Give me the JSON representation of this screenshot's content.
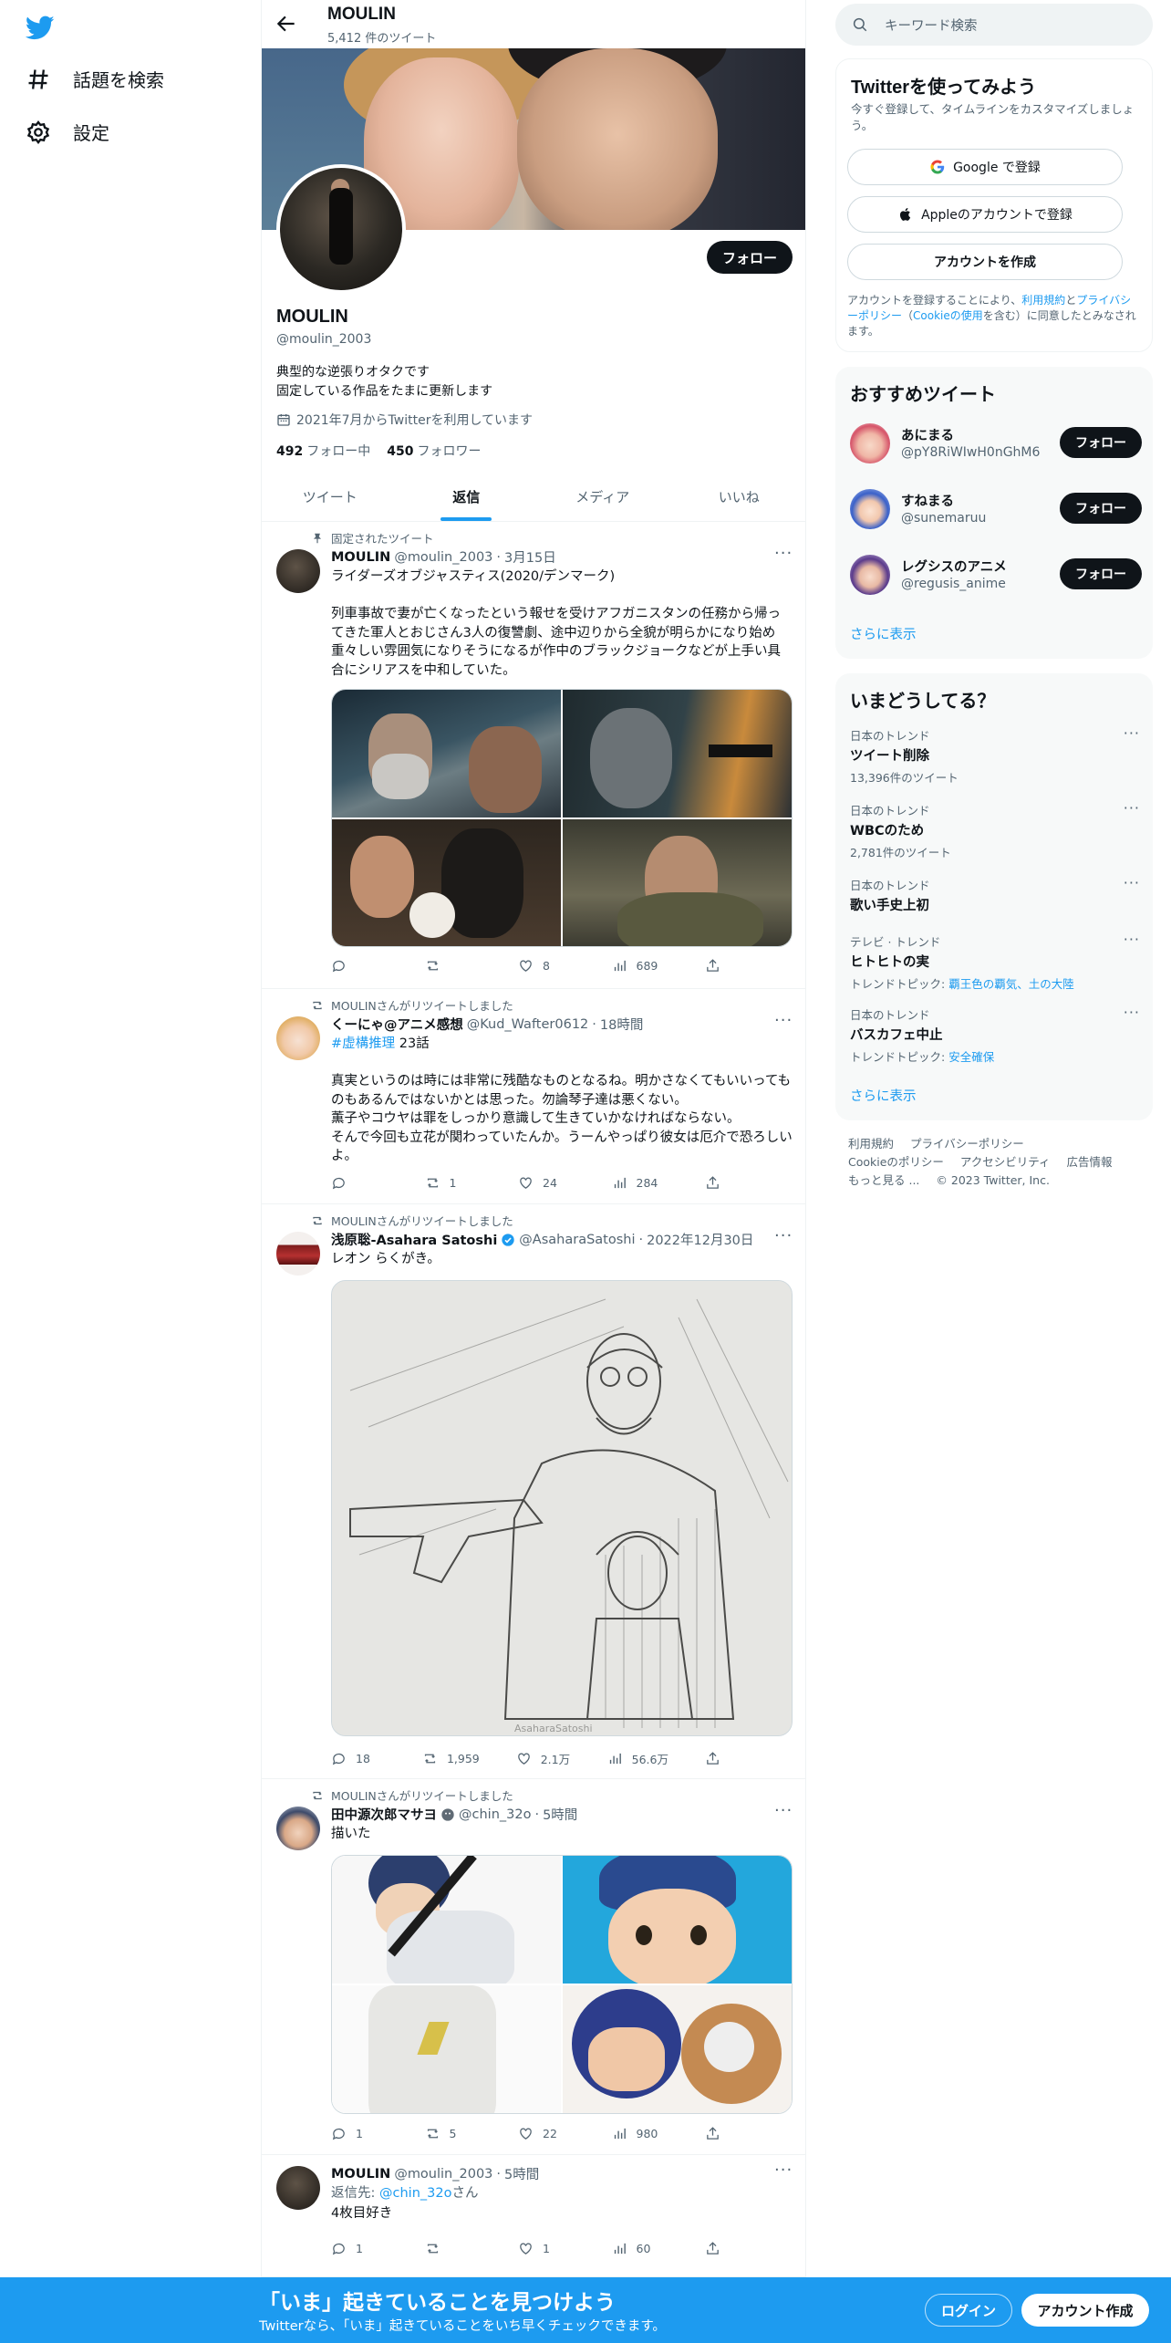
{
  "nav": {
    "explore_label": "話題を検索",
    "settings_label": "設定"
  },
  "header": {
    "title": "MOULIN",
    "tweet_count": "5,412 件のツイート"
  },
  "profile": {
    "follow_label": "フォロー",
    "name": "MOULIN",
    "handle": "@moulin_2003",
    "bio": "典型的な逆張りオタクです\n固定している作品をたまに更新します",
    "joined": "2021年7月からTwitterを利用しています",
    "following_count": "492",
    "following_label": "フォロー中",
    "followers_count": "450",
    "followers_label": "フォロワー"
  },
  "tabs": [
    "ツイート",
    "返信",
    "メディア",
    "いいね"
  ],
  "tweets": [
    {
      "context": "固定されたツイート",
      "name": "MOULIN",
      "handle": "@moulin_2003",
      "sep": "·",
      "time": "3月15日",
      "text": "ライダーズオブジャスティス(2020/デンマーク)\n\n列車事故で妻が亡くなったという報せを受けアフガニスタンの任務から帰ってきた軍人とおじさん3人の復讐劇、途中辺りから全貌が明らかになり始め重々しい雰囲気になりそうになるが作中のブラックジョークなどが上手い具合にシリアスを中和していた。",
      "replies": "",
      "retweets": "",
      "likes": "8",
      "views": "689"
    },
    {
      "context": "MOULINさんがリツイートしました",
      "name": "くーにゃ@アニメ感想",
      "handle": "@Kud_Wafter0612",
      "sep": "·",
      "time": "18時間",
      "hashtag": "#虚構推理",
      "hashtag_after": " 23話",
      "text": "真実というのは時には非常に残酷なものとなるね。明かさなくてもいいってものもあるんではないかとは思った。勿論琴子達は悪くない。\n薫子やコウヤは罪をしっかり意識して生きていかなければならない。\nそんで今回も立花が関わっていたんか。うーんやっぱり彼女は厄介で恐ろしいよ。",
      "replies": "",
      "retweets": "1",
      "likes": "24",
      "views": "284"
    },
    {
      "context": "MOULINさんがリツイートしました",
      "name": "浅原聡-Asahara Satoshi",
      "handle": "@AsaharaSatoshi",
      "sep": "·",
      "time": "2022年12月30日",
      "text": "レオン らくがき。",
      "watermark": "AsaharaSatoshi",
      "replies": "18",
      "retweets": "1,959",
      "likes": "2.1万",
      "views": "56.6万"
    },
    {
      "context": "MOULINさんがリツイートしました",
      "name": "田中源次郎マサヨ",
      "handle": "@chin_32o",
      "sep": "·",
      "time": "5時間",
      "text": "描いた",
      "replies": "1",
      "retweets": "5",
      "likes": "22",
      "views": "980"
    },
    {
      "name": "MOULIN",
      "handle": "@moulin_2003",
      "sep": "·",
      "time": "5時間",
      "reply_to_label": "返信先: ",
      "reply_to_handle": "@chin_32o",
      "reply_to_suffix": "さん",
      "text": "4枚目好き",
      "replies": "1",
      "retweets": "",
      "likes": "1",
      "views": "60"
    }
  ],
  "right": {
    "search_placeholder": "キーワード検索",
    "signup": {
      "title": "Twitterを使ってみよう",
      "subtitle": "今すぐ登録して、タイムラインをカスタマイズしましょう。",
      "google_label": "Google で登録",
      "apple_label": "Appleのアカウントで登録",
      "create_label": "アカウントを作成",
      "legal_prefix": "アカウントを登録することにより、",
      "legal_terms": "利用規約",
      "legal_and": "と",
      "legal_privacy": "プライバシーポリシー",
      "legal_open": "（",
      "legal_cookie": "Cookieの使用",
      "legal_suffix": "を含む）に同意したとみなされます。"
    },
    "recommend": {
      "title": "おすすめツイート",
      "items": [
        {
          "name": "あにまる",
          "handle": "@pY8RiWIwH0nGhM6",
          "button": "フォロー"
        },
        {
          "name": "すねまる",
          "handle": "@sunemaruu",
          "button": "フォロー"
        },
        {
          "name": "レグシスのアニメ",
          "handle": "@regusis_anime",
          "button": "フォロー"
        }
      ],
      "show_more": "さらに表示"
    },
    "trends": {
      "title": "いまどうしてる？",
      "items": [
        {
          "context": "日本のトレンド",
          "name": "ツイート削除",
          "sub": "13,396件のツイート",
          "sub_link": ""
        },
        {
          "context": "日本のトレンド",
          "name": "WBCのため",
          "sub": "2,781件のツイート",
          "sub_link": ""
        },
        {
          "context": "日本のトレンド",
          "name": "歌い手史上初",
          "sub": "",
          "sub_link": ""
        },
        {
          "context": "テレビ · トレンド",
          "name": "ヒトヒトの実",
          "sub": "トレンドトピック: ",
          "sub_link": "覇王色の覇気、土の大陸"
        },
        {
          "context": "日本のトレンド",
          "name": "バスカフェ中止",
          "sub": "トレンドトピック: ",
          "sub_link": "安全確保"
        }
      ],
      "show_more": "さらに表示"
    },
    "footer": {
      "links": [
        "利用規約",
        "プライバシーポリシー",
        "Cookieのポリシー",
        "アクセシビリティ",
        "広告情報",
        "もっと見る ..."
      ],
      "copyright": "© 2023 Twitter, Inc."
    }
  },
  "bottom_bar": {
    "title": "「いま」起きていることを見つけよう",
    "subtitle": "Twitterなら、「いま」起きていることをいち早くチェックできます。",
    "login_label": "ログイン",
    "signup_label": "アカウント作成"
  },
  "colors": {
    "accent": "#1d9bf0",
    "text": "#0f1419",
    "muted": "#536471"
  }
}
